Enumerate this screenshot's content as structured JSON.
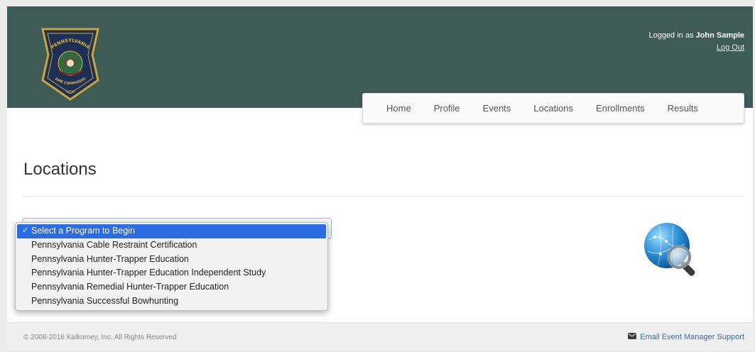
{
  "header": {
    "logo": {
      "top_text": "PENNSYLVANIA",
      "bottom_text": "GAME COMMISSION",
      "year": "1895",
      "icon": "pa-game-commission-keystone-badge"
    },
    "user": {
      "prefix": "Logged in as",
      "name": "John Sample",
      "logout_label": "Log Out"
    }
  },
  "nav": {
    "items": [
      {
        "label": "Home"
      },
      {
        "label": "Profile"
      },
      {
        "label": "Events"
      },
      {
        "label": "Locations"
      },
      {
        "label": "Enrollments"
      },
      {
        "label": "Results"
      }
    ]
  },
  "main": {
    "title": "Locations",
    "program_select": {
      "check_mark": "✓",
      "options": [
        {
          "label": "Select a Program to Begin",
          "selected": true
        },
        {
          "label": "Pennsylvania Cable Restraint Certification",
          "selected": false
        },
        {
          "label": "Pennsylvania Hunter-Trapper Education",
          "selected": false
        },
        {
          "label": "Pennsylvania Hunter-Trapper Education Independent Study",
          "selected": false
        },
        {
          "label": "Pennsylvania Remedial Hunter-Trapper Education",
          "selected": false
        },
        {
          "label": "Pennsylvania Successful Bowhunting",
          "selected": false
        }
      ]
    },
    "illustration": "globe-magnifier-icon"
  },
  "footer": {
    "copyright": "© 2008-2016 Kalkomey, Inc. All Rights Reserved",
    "support_label": "Email Event Manager Support",
    "support_icon": "envelope-icon"
  },
  "colors": {
    "header_bg": "#3e5b56",
    "selected_option_bg": "#2b6be4",
    "link": "#3c6fa5",
    "footer_bg": "#efefef"
  }
}
